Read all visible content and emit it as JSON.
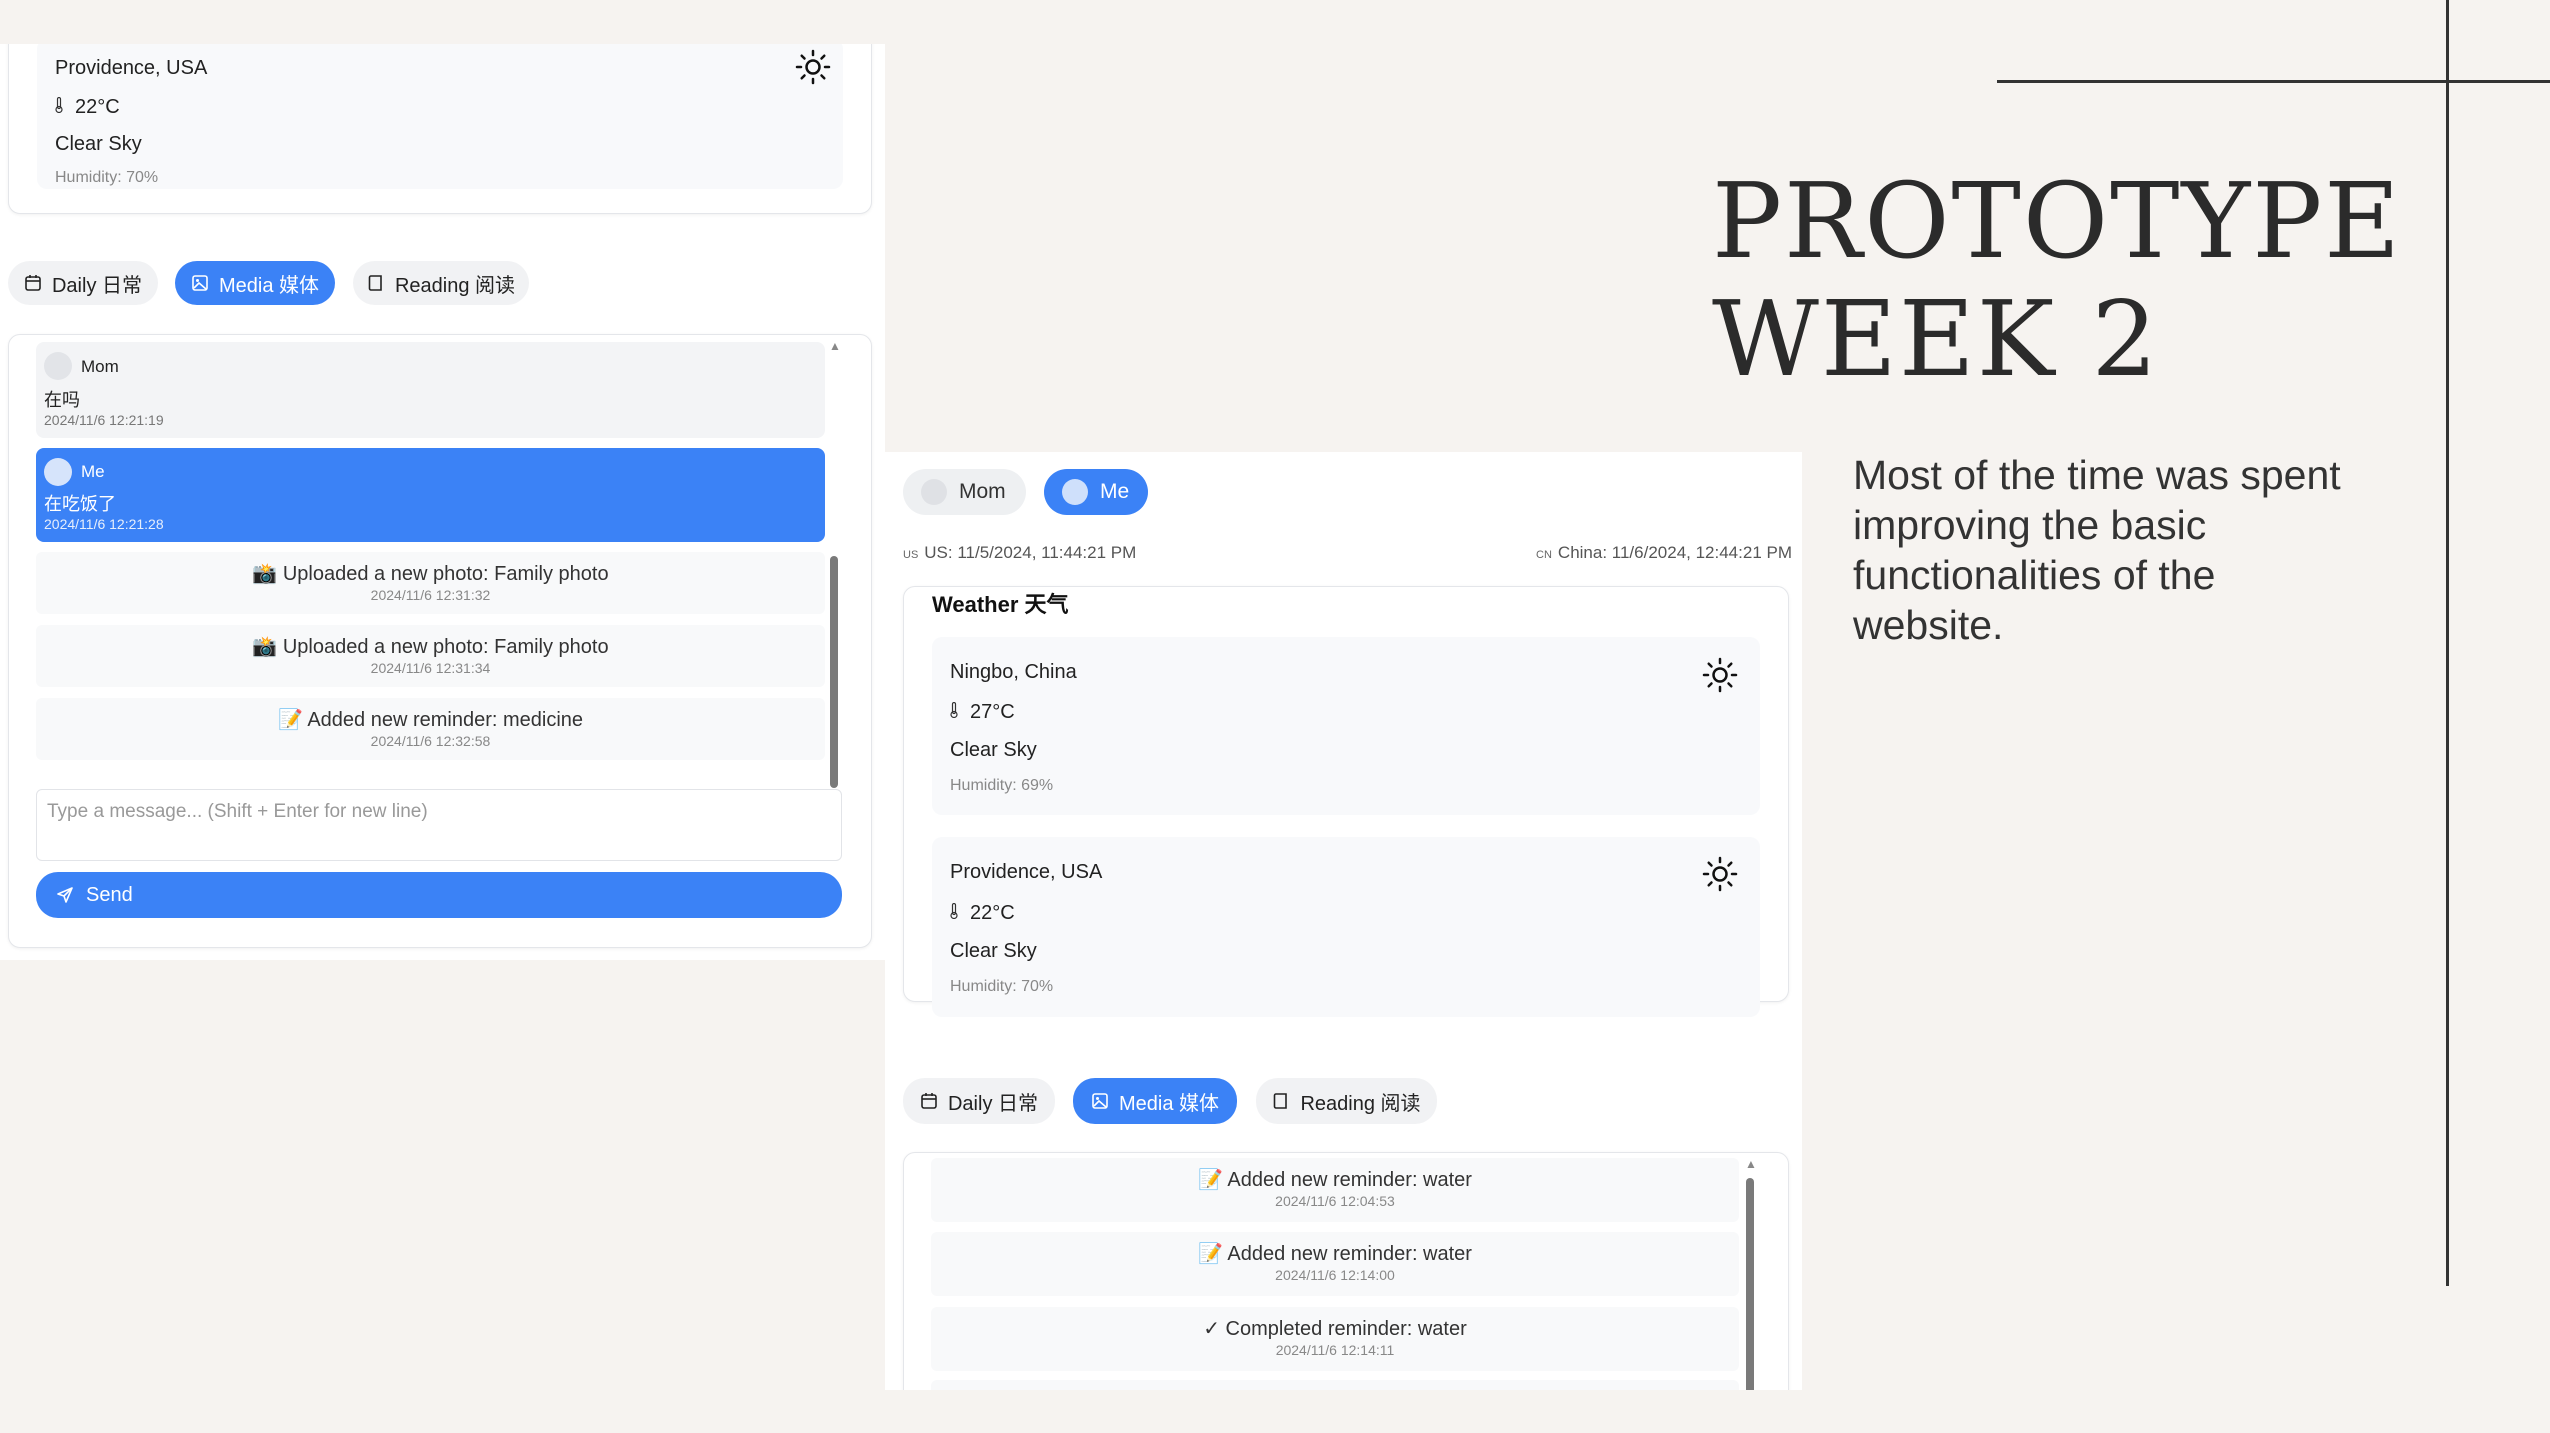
{
  "slide": {
    "title_line1": "PROTOTYPE",
    "title_line2": "WEEK 2",
    "body": "Most of the time was spent improving the basic functionalities of the website."
  },
  "left": {
    "weather": {
      "city": "Providence, USA",
      "temp": "22°C",
      "condition": "Clear Sky",
      "humidity": "Humidity: 70%",
      "icon": "sun-icon"
    },
    "tabs": [
      {
        "label": "Daily 日常",
        "icon": "calendar-icon",
        "active": false
      },
      {
        "label": "Media 媒体",
        "icon": "image-icon",
        "active": true
      },
      {
        "label": "Reading 阅读",
        "icon": "book-icon",
        "active": false
      }
    ],
    "messages": [
      {
        "sender": "Mom",
        "text": "在吗",
        "time": "2024/11/6 12:21:19",
        "self": false
      },
      {
        "sender": "Me",
        "text": "在吃饭了",
        "time": "2024/11/6 12:21:28",
        "self": true
      }
    ],
    "activities": [
      {
        "icon": "📸",
        "text": "Uploaded a new photo: Family photo",
        "time": "2024/11/6 12:31:32"
      },
      {
        "icon": "📸",
        "text": "Uploaded a new photo: Family photo",
        "time": "2024/11/6 12:31:34"
      },
      {
        "icon": "📝",
        "text": "Added new reminder: medicine",
        "time": "2024/11/6 12:32:58"
      }
    ],
    "input_placeholder": "Type a message... (Shift + Enter for new line)",
    "send_label": "Send"
  },
  "right": {
    "users": [
      {
        "label": "Mom",
        "active": false
      },
      {
        "label": "Me",
        "active": true
      }
    ],
    "clock_us": {
      "flag": "US",
      "text": "US: 11/5/2024, 11:44:21 PM"
    },
    "clock_cn": {
      "flag": "CN",
      "text": "China: 11/6/2024, 12:44:21 PM"
    },
    "weather_title": "Weather 天气",
    "weather": [
      {
        "city": "Ningbo, China",
        "temp": "27°C",
        "condition": "Clear Sky",
        "humidity": "Humidity: 69%",
        "icon": "sun-icon"
      },
      {
        "city": "Providence, USA",
        "temp": "22°C",
        "condition": "Clear Sky",
        "humidity": "Humidity: 70%",
        "icon": "sun-icon"
      }
    ],
    "tabs": [
      {
        "label": "Daily 日常",
        "icon": "calendar-icon",
        "active": false
      },
      {
        "label": "Media 媒体",
        "icon": "image-icon",
        "active": true
      },
      {
        "label": "Reading 阅读",
        "icon": "book-icon",
        "active": false
      }
    ],
    "activities": [
      {
        "icon": "📝",
        "text": "Added new reminder: water",
        "time": "2024/11/6 12:04:53"
      },
      {
        "icon": "📝",
        "text": "Added new reminder: water",
        "time": "2024/11/6 12:14:00"
      },
      {
        "icon": "✓",
        "text": "Completed reminder: water",
        "time": "2024/11/6 12:14:11"
      }
    ]
  },
  "colors": {
    "accent": "#3b82f6",
    "background": "#f6f3f0"
  }
}
